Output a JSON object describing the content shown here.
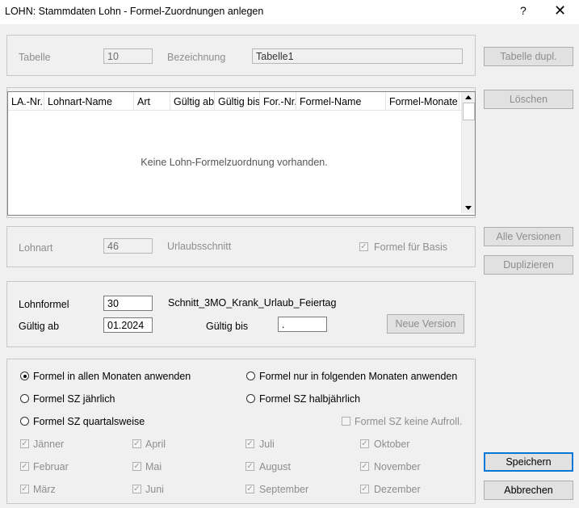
{
  "window": {
    "title": "LOHN: Stammdaten Lohn - Formel-Zuordnungen anlegen",
    "help": "?",
    "close": "✕"
  },
  "table_group": {
    "tabelle_label": "Tabelle",
    "tabelle_value": "10",
    "bezeichnung_label": "Bezeichnung",
    "bezeichnung_value": "Tabelle1"
  },
  "list": {
    "columns": [
      "LA.-Nr.",
      "Lohnart-Name",
      "Art",
      "Gültig ab",
      "Gültig bis",
      "For.-Nr.",
      "Formel-Name",
      "Formel-Monate"
    ],
    "empty_text": "Keine Lohn-Formelzuordnung vorhanden."
  },
  "lohnart_group": {
    "lohnart_label": "Lohnart",
    "lohnart_value": "46",
    "urlaub_label": "Urlaubsschnitt",
    "formel_basis_label": "Formel für Basis",
    "formel_basis_checked": true
  },
  "formel_group": {
    "lohnformel_label": "Lohnformel",
    "lohnformel_value": "30",
    "lohnformel_name": "Schnitt_3MO_Krank_Urlaub_Feiertag",
    "gueltig_ab_label": "Gültig ab",
    "gueltig_ab_value": "01.2024",
    "gueltig_bis_label": "Gültig bis",
    "gueltig_bis_value": ".",
    "neue_version": "Neue Version"
  },
  "months_group": {
    "radios": [
      {
        "label": "Formel in allen Monaten anwenden",
        "selected": true
      },
      {
        "label": "Formel nur in folgenden Monaten anwenden",
        "selected": false
      },
      {
        "label": "Formel SZ jährlich",
        "selected": false
      },
      {
        "label": "Formel SZ halbjährlich",
        "selected": false
      },
      {
        "label": "Formel SZ quartalsweise",
        "selected": false
      }
    ],
    "keine_aufroll": "Formel SZ keine Aufroll.",
    "months": [
      "Jänner",
      "April",
      "Juli",
      "Oktober",
      "Februar",
      "Mai",
      "August",
      "November",
      "März",
      "Juni",
      "September",
      "Dezember"
    ]
  },
  "buttons": {
    "tabelle_dupl": "Tabelle dupl.",
    "loeschen": "Löschen",
    "alle_versionen": "Alle Versionen",
    "duplizieren": "Duplizieren",
    "speichern": "Speichern",
    "abbrechen": "Abbrechen"
  }
}
